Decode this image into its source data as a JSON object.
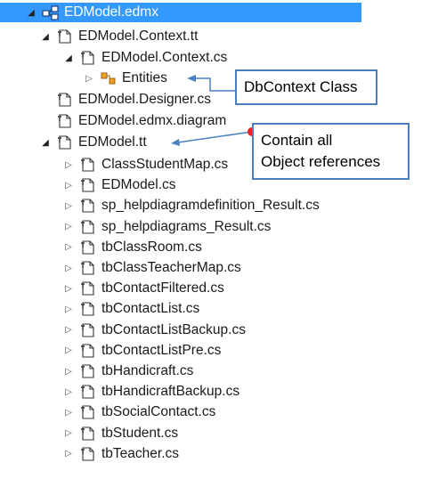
{
  "tree": {
    "root": {
      "label": "EDModel.edmx",
      "icon": "edmx-icon"
    },
    "context_tt": {
      "label": "EDModel.Context.tt",
      "icon": "tt-file-icon"
    },
    "context_cs": {
      "label": "EDModel.Context.cs",
      "icon": "cs-file-icon"
    },
    "entities": {
      "label": "Entities",
      "icon": "class-icon"
    },
    "designer": {
      "label": "EDModel.Designer.cs",
      "icon": "cs-file-icon"
    },
    "diagram": {
      "label": "EDModel.edmx.diagram",
      "icon": "file-icon"
    },
    "model_tt": {
      "label": "EDModel.tt",
      "icon": "tt-file-icon"
    },
    "model_children": [
      {
        "label": "ClassStudentMap.cs"
      },
      {
        "label": "EDModel.cs"
      },
      {
        "label": "sp_helpdiagramdefinition_Result.cs"
      },
      {
        "label": "sp_helpdiagrams_Result.cs"
      },
      {
        "label": "tbClassRoom.cs"
      },
      {
        "label": "tbClassTeacherMap.cs"
      },
      {
        "label": "tbContactFiltered.cs"
      },
      {
        "label": "tbContactList.cs"
      },
      {
        "label": "tbContactListBackup.cs"
      },
      {
        "label": "tbContactListPre.cs"
      },
      {
        "label": "tbHandicraft.cs"
      },
      {
        "label": "tbHandicraftBackup.cs"
      },
      {
        "label": "tbSocialContact.cs"
      },
      {
        "label": "tbStudent.cs"
      },
      {
        "label": "tbTeacher.cs"
      }
    ]
  },
  "callouts": {
    "dbcontext": "DbContext Class",
    "references_line1": "Contain all",
    "references_line2": "Object references"
  },
  "colors": {
    "selection": "#3399ff",
    "callout_border": "#4a7fc1",
    "pointer": "#4a7fc1",
    "dot": "#e0262b"
  }
}
